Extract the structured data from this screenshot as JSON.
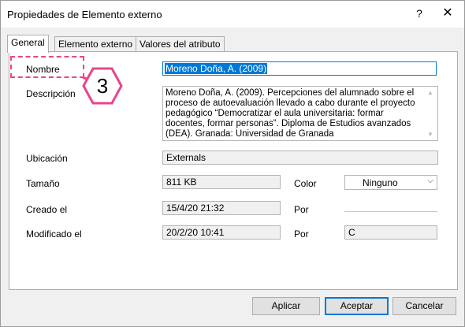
{
  "window": {
    "title": "Propiedades de Elemento externo",
    "help_glyph": "?",
    "close_glyph": "✕"
  },
  "tabs": [
    {
      "label": "General",
      "active": true
    },
    {
      "label": "Elemento externo",
      "active": false
    },
    {
      "label": "Valores del atributo",
      "active": false
    }
  ],
  "form": {
    "nombre_label": "Nombre",
    "nombre_value": "Moreno Doña, A. (2009)",
    "descripcion_label": "Descripción",
    "descripcion_value": "Moreno Doña, A. (2009). Percepciones del alumnado sobre el proceso de autoevaluación llevado a cabo durante el proyecto pedagógico “Democratizar el aula universitaria: formar docentes, formar personas”. Diploma de Estudios avanzados (DEA). Granada: Universidad de Granada",
    "ubicacion_label": "Ubicación",
    "ubicacion_value": "Externals",
    "tamano_label": "Tamaño",
    "tamano_value": "811 KB",
    "color_label": "Color",
    "color_value": "Ninguno",
    "creado_label": "Creado el",
    "creado_value": "15/4/20 21:32",
    "por_label_1": "Por",
    "por_value_1": "",
    "modificado_label": "Modificado el",
    "modificado_value": "20/2/20 10:41",
    "por_label_2": "Por",
    "por_value_2": "C"
  },
  "buttons": {
    "aplicar": "Aplicar",
    "aceptar": "Aceptar",
    "cancelar": "Cancelar"
  },
  "callout": {
    "number": "3",
    "color": "#e8458b"
  }
}
